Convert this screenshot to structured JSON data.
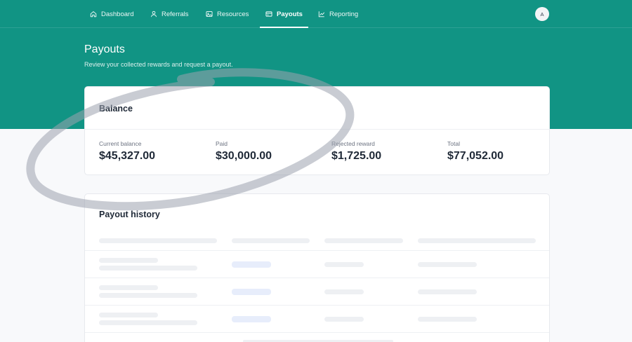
{
  "nav": {
    "items": [
      {
        "label": "Dashboard",
        "icon": "home-icon"
      },
      {
        "label": "Referrals",
        "icon": "user-icon"
      },
      {
        "label": "Resources",
        "icon": "image-icon"
      },
      {
        "label": "Payouts",
        "icon": "wallet-icon",
        "active": true
      },
      {
        "label": "Reporting",
        "icon": "chart-line-icon"
      }
    ],
    "avatar_initial": "A"
  },
  "header": {
    "title": "Payouts",
    "subtitle": "Review your collected rewards and request a payout."
  },
  "balance": {
    "title": "Balance",
    "stats": [
      {
        "label": "Current balance",
        "value": "$45,327.00"
      },
      {
        "label": "Paid",
        "value": "$30,000.00"
      },
      {
        "label": "Rejected reward",
        "value": "$1,725.00"
      },
      {
        "label": "Total",
        "value": "$77,052.00"
      }
    ]
  },
  "history": {
    "title": "Payout history"
  },
  "colors": {
    "brand": "#119484",
    "skeleton": "#eef0f3",
    "skeleton_accent": "#e7edfb"
  }
}
